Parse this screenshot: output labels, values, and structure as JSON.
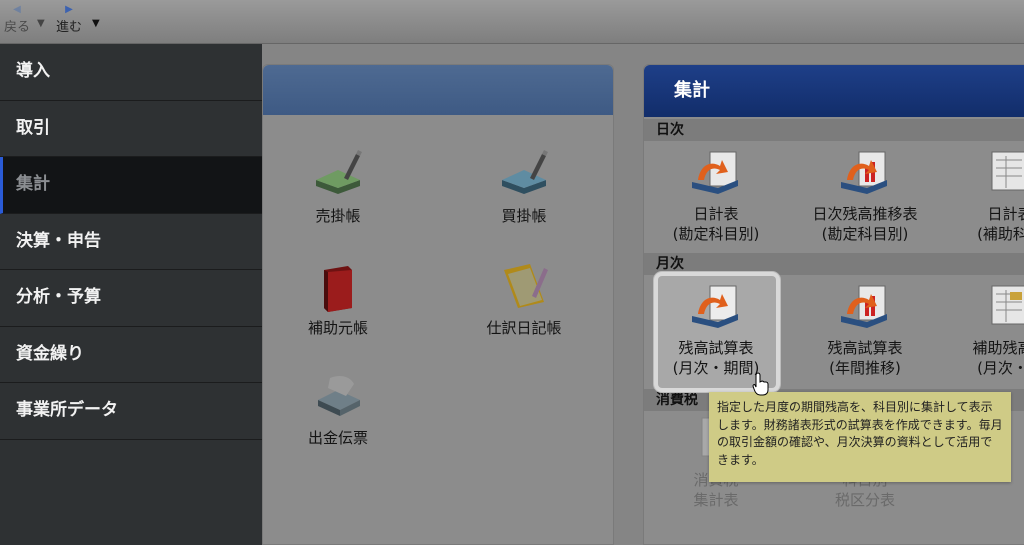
{
  "toolbar": {
    "back_label": "戻る",
    "forward_label": "進む"
  },
  "sidebar": {
    "items": [
      {
        "label": "導入"
      },
      {
        "label": "取引"
      },
      {
        "label": "集計",
        "active": true
      },
      {
        "label": "決算・申告"
      },
      {
        "label": "分析・予算"
      },
      {
        "label": "資金繰り"
      },
      {
        "label": "事業所データ"
      }
    ]
  },
  "left_panel": {
    "tiles": [
      {
        "label": "売掛帳",
        "icon": "ledger-pen-icon"
      },
      {
        "label": "買掛帳",
        "icon": "ledger-pen-icon"
      },
      {
        "label": "補助元帳",
        "icon": "red-book-icon"
      },
      {
        "label": "仕訳日記帳",
        "icon": "journal-pen-icon"
      },
      {
        "label": "出金伝票",
        "icon": "voucher-icon"
      }
    ]
  },
  "right_panel": {
    "title": "集計",
    "sections": {
      "daily": "日次",
      "monthly": "月次",
      "tax": "消費税"
    },
    "daily_tiles": [
      {
        "line1": "日計表",
        "line2": "(勘定科目別)"
      },
      {
        "line1": "日次残高推移表",
        "line2": "(勘定科目別)"
      },
      {
        "line1": "日計表",
        "line2": "(補助科目"
      }
    ],
    "monthly_tiles": [
      {
        "line1": "残高試算表",
        "line2": "(月次・期間)"
      },
      {
        "line1": "残高試算表",
        "line2": "(年間推移)"
      },
      {
        "line1": "補助残高一",
        "line2": "(月次・期"
      }
    ],
    "tax_tiles": [
      {
        "line1": "消費税",
        "line2": "集計表"
      },
      {
        "line1": "科目別",
        "line2": "税区分表"
      }
    ]
  },
  "tooltip": {
    "text": "指定した月度の期間残高を、科目別に集計して表示します。財務諸表形式の試算表を作成できます。毎月の取引金額の確認や、月次決算の資料として活用できます。"
  },
  "colors": {
    "sidebar_bg": "#2e3133",
    "active_bar": "#2a5bd7",
    "panel_header": "#1e3f88",
    "tooltip_bg": "#cfcb86"
  }
}
